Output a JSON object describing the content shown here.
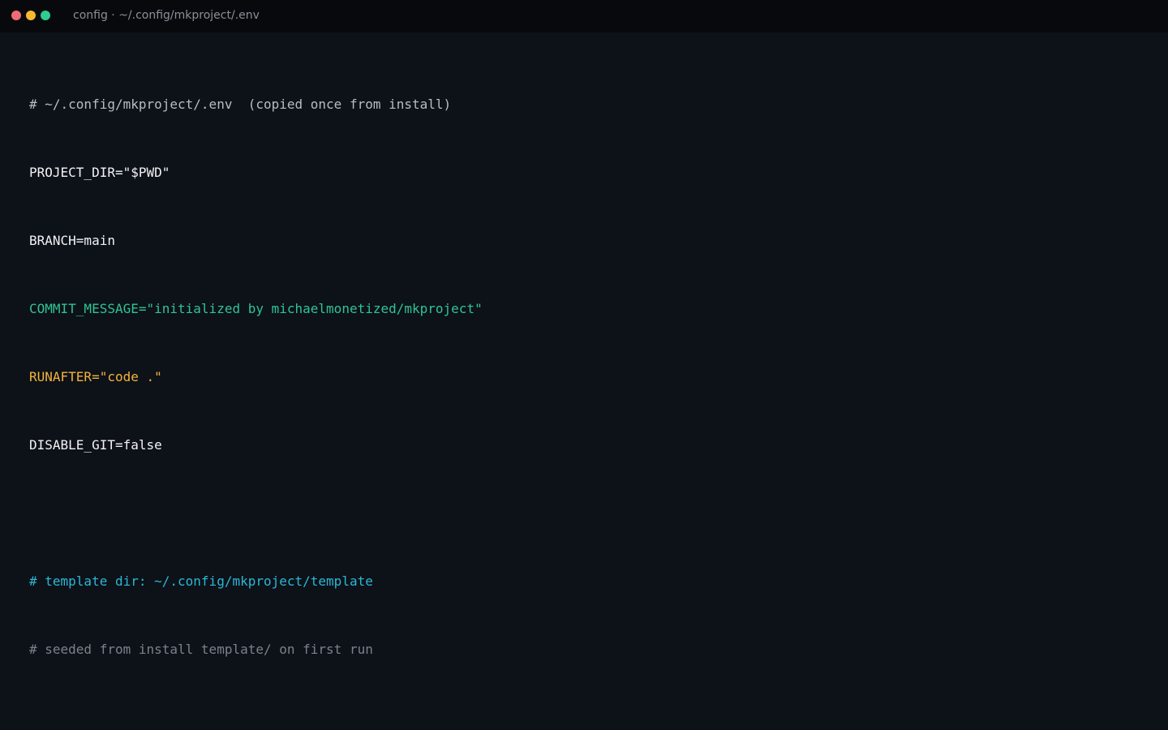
{
  "window": {
    "title": "config · ~/.config/mkproject/.env",
    "controls": {
      "close_color": "#ef6b73",
      "minimize_color": "#f5b82e",
      "maximize_color": "#2ecc8f"
    }
  },
  "editor": {
    "lines": [
      {
        "text": "# ~/.config/mkproject/.env  (copied once from install)",
        "color": "#b9bcc2"
      },
      {
        "text": "PROJECT_DIR=\"$PWD\"",
        "color": "#f2f3f5"
      },
      {
        "text": "BRANCH=main",
        "color": "#f2f3f5"
      },
      {
        "text": "COMMIT_MESSAGE=\"initialized by michaelmonetized/mkproject\"",
        "color": "#2fc493"
      },
      {
        "text": "RUNAFTER=\"code .\"",
        "color": "#f2b33d"
      },
      {
        "text": "DISABLE_GIT=false",
        "color": "#f2f3f5"
      },
      {
        "text": "",
        "color": "#f2f3f5"
      },
      {
        "text": "# template dir: ~/.config/mkproject/template",
        "color": "#2bb8d6"
      },
      {
        "text": "# seeded from install template/ on first run",
        "color": "#7d8189"
      }
    ]
  }
}
